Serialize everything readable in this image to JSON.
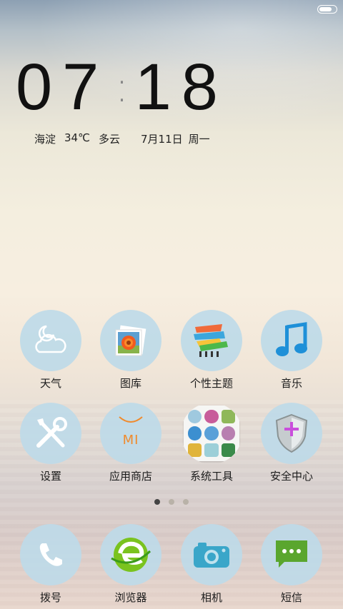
{
  "status_bar": {
    "battery_level": 0.75
  },
  "clock": {
    "hours": "07",
    "minutes": "18"
  },
  "weather": {
    "location": "海淀",
    "temperature": "34℃",
    "condition": "多云"
  },
  "date": {
    "day": "7月11日",
    "weekday": "周一"
  },
  "apps_row1": [
    {
      "label": "天气",
      "icon": "weather-icon"
    },
    {
      "label": "图库",
      "icon": "gallery-icon"
    },
    {
      "label": "个性主题",
      "icon": "themes-icon"
    },
    {
      "label": "音乐",
      "icon": "music-icon"
    }
  ],
  "apps_row2": [
    {
      "label": "设置",
      "icon": "settings-icon"
    },
    {
      "label": "应用商店",
      "icon": "app-store-icon",
      "icon_text": "MI"
    },
    {
      "label": "系统工具",
      "icon": "system-tools-folder-icon"
    },
    {
      "label": "安全中心",
      "icon": "security-shield-icon"
    }
  ],
  "dock": [
    {
      "label": "拨号",
      "icon": "phone-icon"
    },
    {
      "label": "浏览器",
      "icon": "browser-icon"
    },
    {
      "label": "相机",
      "icon": "camera-icon"
    },
    {
      "label": "短信",
      "icon": "messages-icon"
    }
  ],
  "pager": {
    "pages": 3,
    "current": 1
  },
  "colors": {
    "icon_bg": "#bedae8",
    "music": "#1e90d8",
    "browser_green": "#7ac31e",
    "shield_plus": "#c94fdc",
    "camera": "#3aa6c9",
    "message_green": "#5aa62e",
    "app_store_orange": "#f08a2c"
  }
}
